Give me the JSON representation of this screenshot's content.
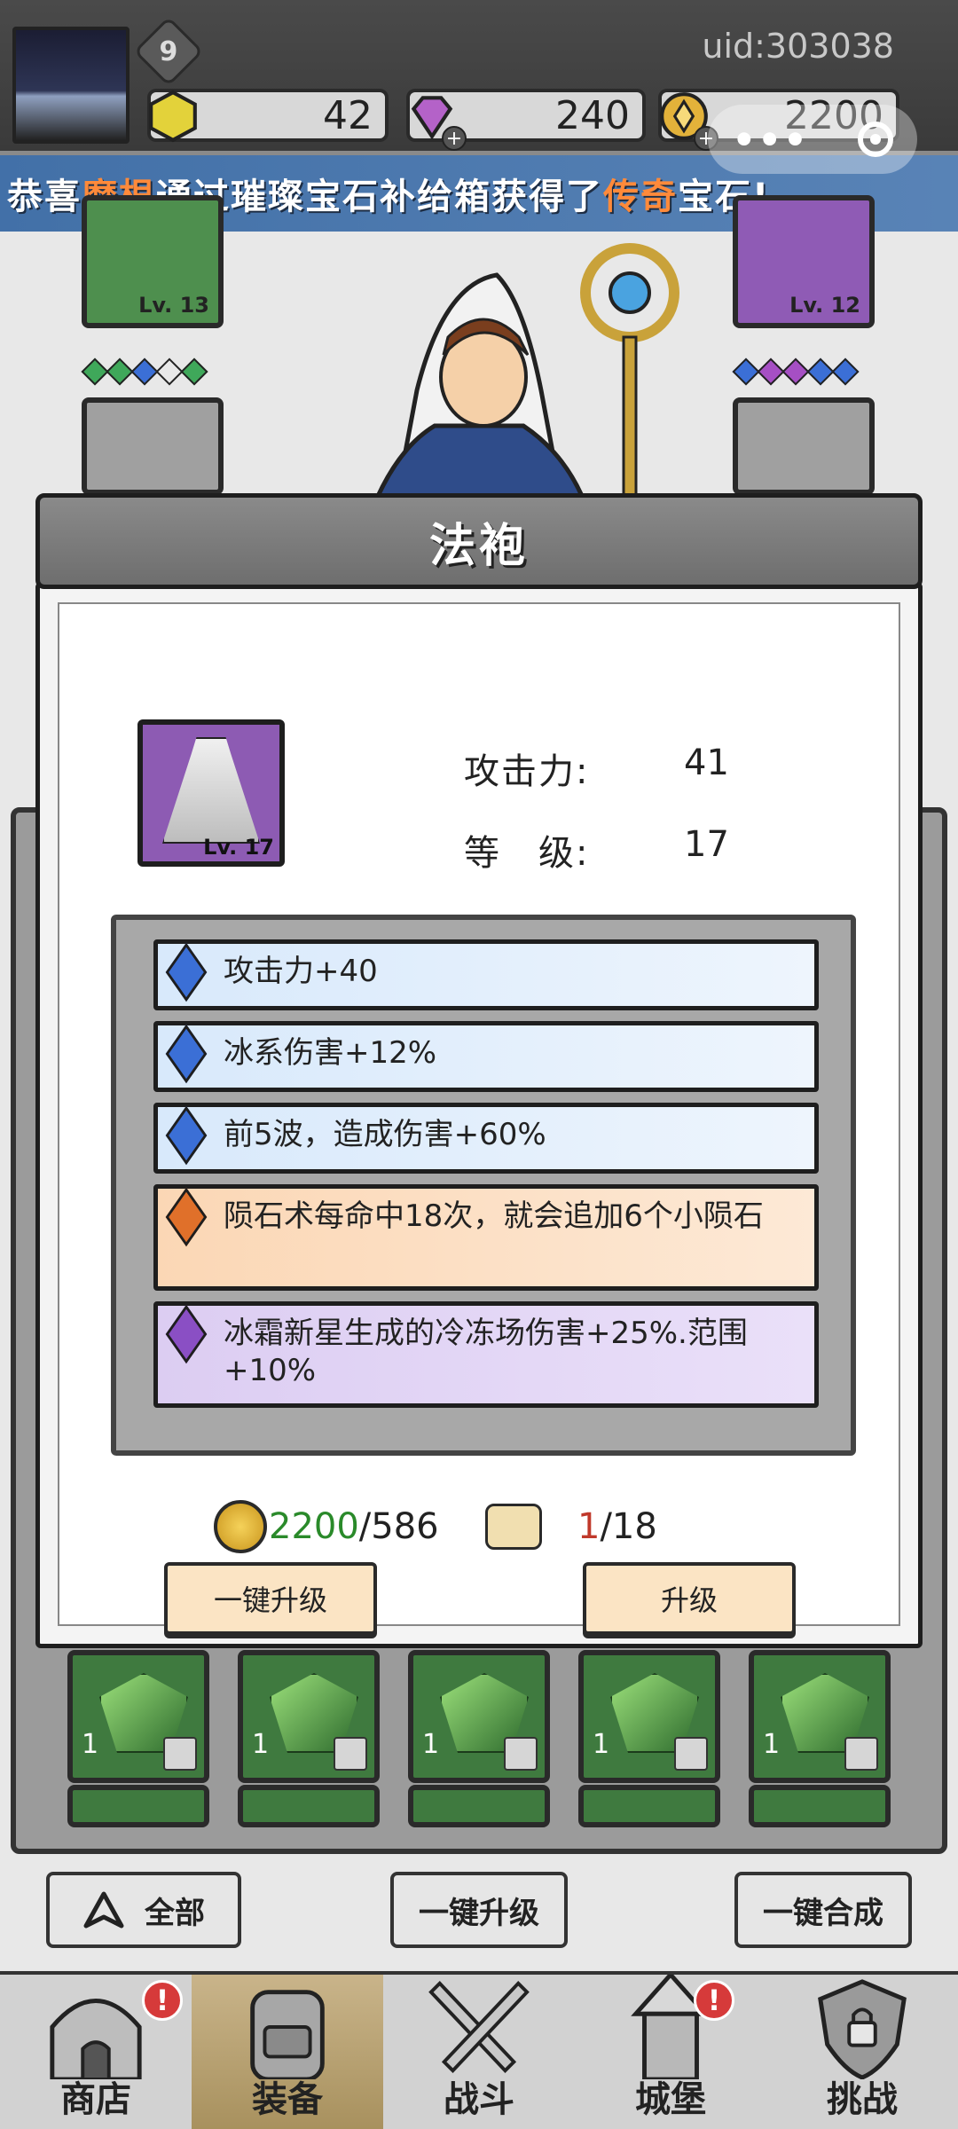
{
  "player": {
    "level": "9",
    "uid": "uid:303038"
  },
  "resources": {
    "gold_hex": "42",
    "diamonds": "240",
    "coins": "2200"
  },
  "notice": {
    "prefix": "恭喜",
    "player_name": "摩根",
    "middle": "通过璀璨宝石补给箱获得了",
    "rarity": "传奇",
    "suffix": "宝石!"
  },
  "equipment_slots": {
    "left_top_level": "Lv. 13",
    "right_top_level": "Lv. 12"
  },
  "modal": {
    "title": "法袍",
    "item_level_badge": "Lv. 17",
    "stats": [
      {
        "label": "攻击力:",
        "value": "41"
      },
      {
        "label": "等　级:",
        "value": "17"
      }
    ],
    "bonuses": [
      {
        "text": "攻击力+40",
        "tier": "blue"
      },
      {
        "text": "冰系伤害+12%",
        "tier": "blue"
      },
      {
        "text": "前5波，造成伤害+60%",
        "tier": "blue"
      },
      {
        "text": "陨石术每命中18次，就会追加6个小陨石",
        "tier": "orange"
      },
      {
        "text": "冰霜新星生成的冷冻场伤害+25%.范围+10%",
        "tier": "violet"
      }
    ],
    "cost": {
      "coins_have": "2200",
      "coins_need": "/586",
      "scroll_have": "1",
      "scroll_need": "/18"
    },
    "buttons": {
      "auto_upgrade": "一键升级",
      "upgrade": "升级"
    }
  },
  "inventory": {
    "row1": [
      {
        "count": "1"
      },
      {
        "count": "1"
      },
      {
        "count": "1"
      },
      {
        "count": "1"
      },
      {
        "count": "1"
      }
    ]
  },
  "bottom_actions": {
    "filter": "全部",
    "auto_upgrade": "一键升级",
    "auto_merge": "一键合成"
  },
  "nav": [
    {
      "label": "商店",
      "badge": "!"
    },
    {
      "label": "装备",
      "badge": ""
    },
    {
      "label": "战斗",
      "badge": ""
    },
    {
      "label": "城堡",
      "badge": "!"
    },
    {
      "label": "挑战",
      "badge": ""
    }
  ],
  "colors": {
    "notice_highlight": "#ff8a3a",
    "coins_have": "#2a8a2a",
    "scroll_have": "#c0392b"
  }
}
